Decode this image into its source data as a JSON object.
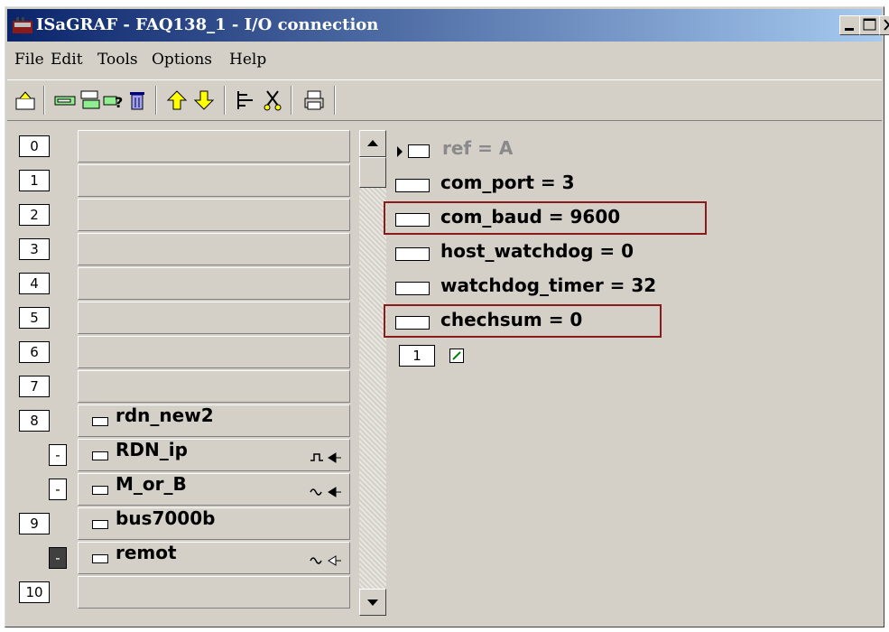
{
  "window": {
    "title": "ISaGRAF - FAQ138_1 - I/O connection"
  },
  "menu": [
    "File",
    "Edit",
    "Tools",
    "Options",
    "Help"
  ],
  "toolbar_icons": [
    "open-icon",
    "board-icon",
    "copy-board-icon",
    "help-icon",
    "delete-icon",
    "up-arrow-icon",
    "down-arrow-icon",
    "tree-icon",
    "cut-icon",
    "print-icon"
  ],
  "slots": [
    {
      "num": "0",
      "label": ""
    },
    {
      "num": "1",
      "label": ""
    },
    {
      "num": "2",
      "label": ""
    },
    {
      "num": "3",
      "label": ""
    },
    {
      "num": "4",
      "label": ""
    },
    {
      "num": "5",
      "label": ""
    },
    {
      "num": "6",
      "label": ""
    },
    {
      "num": "7",
      "label": ""
    },
    {
      "num": "8",
      "label": "rdn_new2"
    },
    {
      "num": "-",
      "label": "RDN_ip"
    },
    {
      "num": "-",
      "label": "M_or_B"
    },
    {
      "num": "9",
      "label": "bus7000b"
    },
    {
      "num": "-",
      "label": "remot"
    },
    {
      "num": "10",
      "label": ""
    }
  ],
  "params": [
    {
      "text": "ref = A"
    },
    {
      "text": "com_port = 3"
    },
    {
      "text": "com_baud = 9600"
    },
    {
      "text": "host_watchdog = 0"
    },
    {
      "text": "watchdog_timer = 32"
    },
    {
      "text": "chechsum = 0"
    }
  ],
  "channel": {
    "num": "1"
  }
}
